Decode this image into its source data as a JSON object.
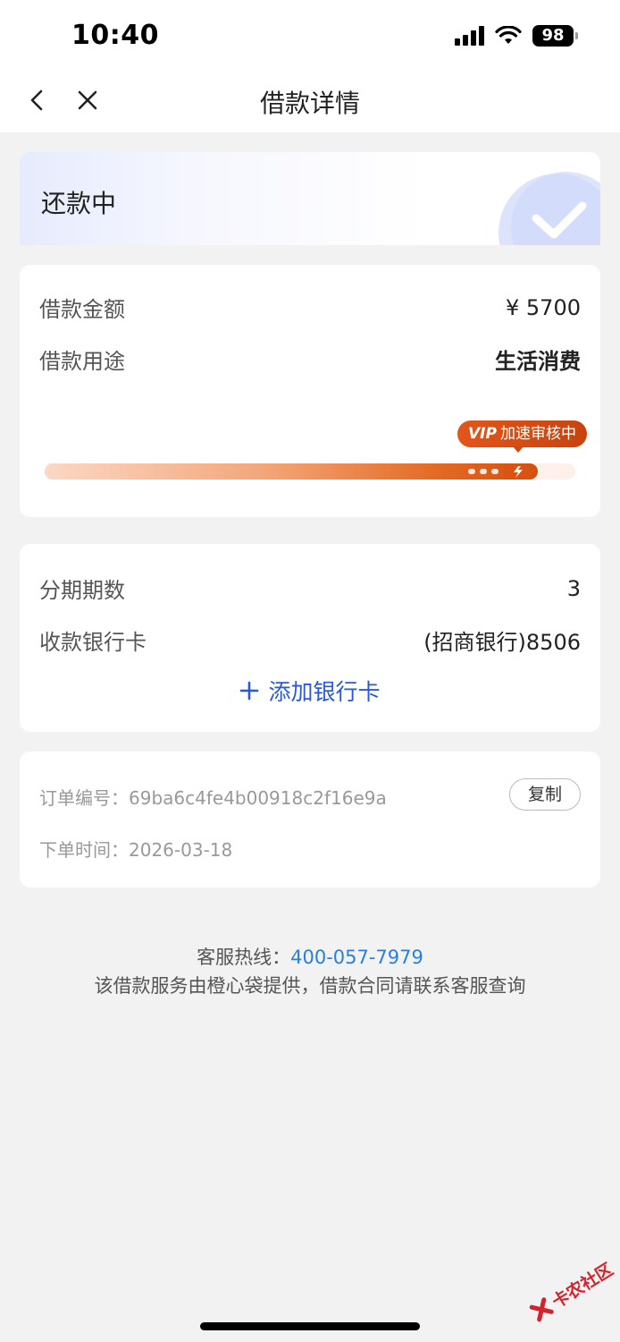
{
  "status_bar": {
    "time": "10:40",
    "battery": "98"
  },
  "nav": {
    "title": "借款详情",
    "back_icon": "chevron-left-icon",
    "close_icon": "close-icon"
  },
  "status_card": {
    "status": "还款中",
    "icon": "check-circle-icon"
  },
  "loan": {
    "amount_label": "借款金额",
    "amount_value": "¥ 5700",
    "purpose_label": "借款用途",
    "purpose_value": "生活消费",
    "vip_prefix": "VIP",
    "vip_text": "加速审核中",
    "progress": 0.93,
    "accent_color": "#d9581c"
  },
  "installment": {
    "periods_label": "分期期数",
    "periods_value": "3",
    "bank_label": "收款银行卡",
    "bank_value": "(招商银行)8506",
    "add_card_label": "添加银行卡",
    "link_color": "#2a59d8"
  },
  "order": {
    "number_label": "订单编号：",
    "number_value": "69ba6c4fe4b00918c2f16e9a",
    "copy_label": "复制",
    "time_label": "下单时间：",
    "time_value": "2026-03-18"
  },
  "footer": {
    "hotline_label": "客服热线：",
    "hotline_value": "400-057-7979",
    "notice": "该借款服务由橙心袋提供，借款合同请联系客服查询",
    "hotline_color": "#2a7de1"
  },
  "watermark": {
    "text": "卡农社区"
  }
}
